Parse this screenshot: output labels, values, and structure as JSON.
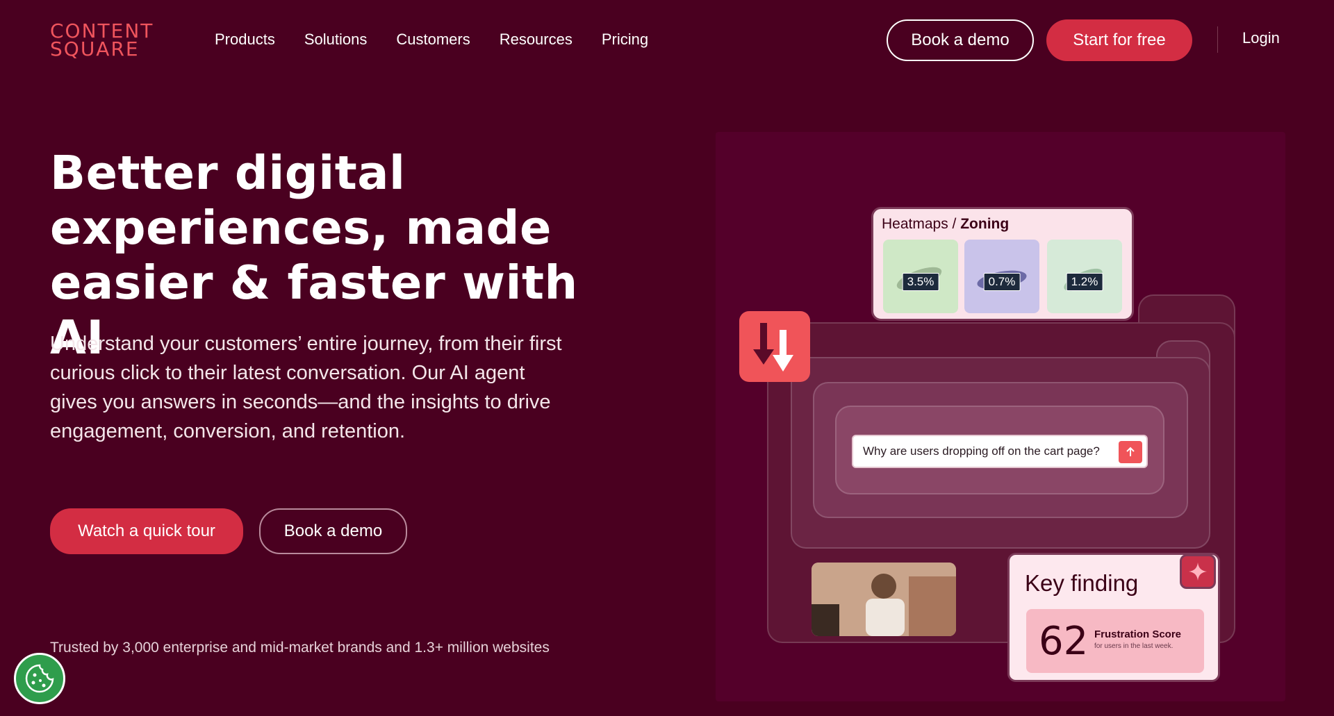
{
  "header": {
    "logo_line1": "CONTENT",
    "logo_line2": "SQUARE",
    "nav": [
      "Products",
      "Solutions",
      "Customers",
      "Resources",
      "Pricing"
    ],
    "book_demo": "Book a demo",
    "start_free": "Start for free",
    "login": "Login"
  },
  "hero": {
    "headline_1": "Better digital",
    "headline_2": "experiences, made",
    "headline_3": "easier & faster with AI",
    "subtext": "Understand your customers’ entire journey, from their first curious click to their latest conversation. Our AI agent gives you answers in seconds—and the insights to drive engagement, conversion, and retention.",
    "cta_tour": "Watch a quick tour",
    "cta_demo": "Book a demo",
    "trusted": "Trusted by 3,000 enterprise and mid-market brands and 1.3+ million websites"
  },
  "visual": {
    "heatmaps_label": "Heatmaps /",
    "zoning_label": "Zoning",
    "percentages": [
      "3.5%",
      "0.7%",
      "1.2%"
    ],
    "question": "Why are users dropping off on the cart page?",
    "key_finding": "Key finding",
    "score": "62",
    "score_label": "Frustration Score",
    "score_sub": "for users in the last week."
  },
  "colors": {
    "background": "#4a0020",
    "accent": "#d32d43",
    "logo": "#f0555d"
  }
}
